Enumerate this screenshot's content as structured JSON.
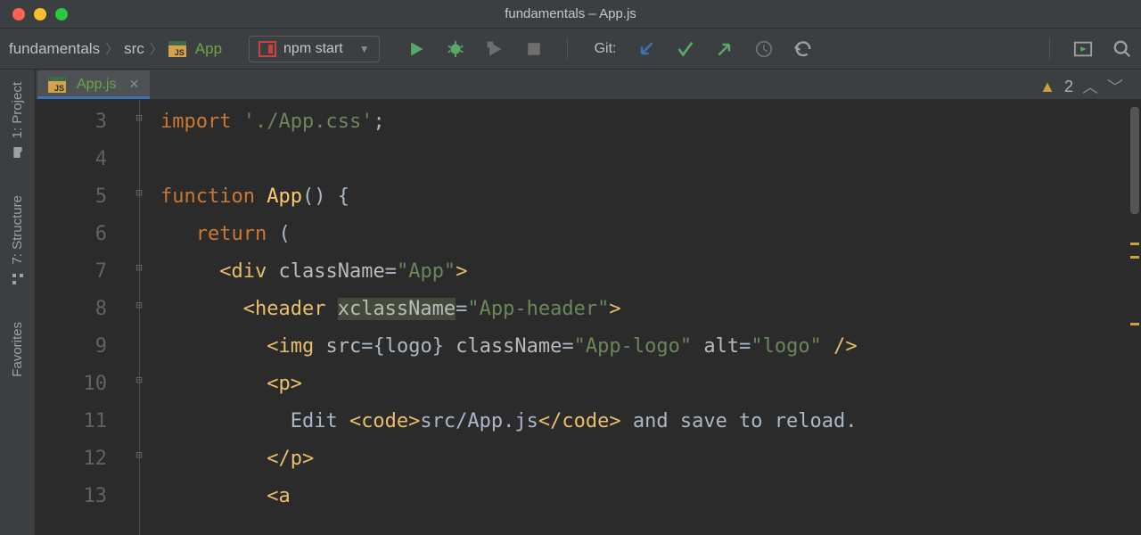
{
  "window": {
    "title": "fundamentals – App.js"
  },
  "breadcrumbs": {
    "root": "fundamentals",
    "src": "src",
    "file": "App"
  },
  "run_config": {
    "label": "npm start"
  },
  "git": {
    "label": "Git:"
  },
  "left_rail": {
    "project": "1: Project",
    "structure": "7: Structure",
    "favorites": "Favorites"
  },
  "tab": {
    "name": "App.js"
  },
  "inspection": {
    "warn_count": "2"
  },
  "gutter": {
    "l3": "3",
    "l4": "4",
    "l5": "5",
    "l6": "6",
    "l7": "7",
    "l8": "8",
    "l9": "9",
    "l10": "10",
    "l11": "11",
    "l12": "12",
    "l13": "13"
  },
  "code": {
    "l3": {
      "kw": "import",
      "str": "'./App.css'",
      "semi": ";"
    },
    "l4": {
      "blank": ""
    },
    "l5": {
      "kw": "function",
      "fn": "App",
      "parens": "()",
      "brace": " {"
    },
    "l6": {
      "indent": "   ",
      "kw": "return",
      "paren": " ("
    },
    "l7": {
      "indent": "     ",
      "open": "<",
      "tag": "div",
      "sp": " ",
      "attr": "className",
      "eq": "=",
      "str": "\"App\"",
      "close": ">"
    },
    "l8": {
      "indent": "       ",
      "open": "<",
      "tag": "header",
      "sp": " ",
      "attr": "xclassName",
      "eq": "=",
      "str": "\"App-header\"",
      "close": ">"
    },
    "l9": {
      "indent": "         ",
      "open": "<",
      "tag": "img",
      "sp": " ",
      "a1": "src",
      "eq1": "=",
      "v1": "{logo}",
      "sp2": " ",
      "a2": "className",
      "eq2": "=",
      "v2": "\"App-logo\"",
      "sp3": " ",
      "a3": "alt",
      "eq3": "=",
      "v3": "\"logo\"",
      "close": " />"
    },
    "l10": {
      "indent": "         ",
      "open": "<",
      "tag": "p",
      "close": ">"
    },
    "l11": {
      "indent": "           ",
      "t1": "Edit ",
      "open1": "<",
      "tag1": "code",
      "close1": ">",
      "t2": "src/App.js",
      "open2": "</",
      "tag2": "code",
      "close2": ">",
      "t3": " and save to reload."
    },
    "l12": {
      "indent": "         ",
      "open": "</",
      "tag": "p",
      "close": ">"
    },
    "l13": {
      "indent": "         ",
      "open": "<",
      "tag": "a"
    }
  }
}
